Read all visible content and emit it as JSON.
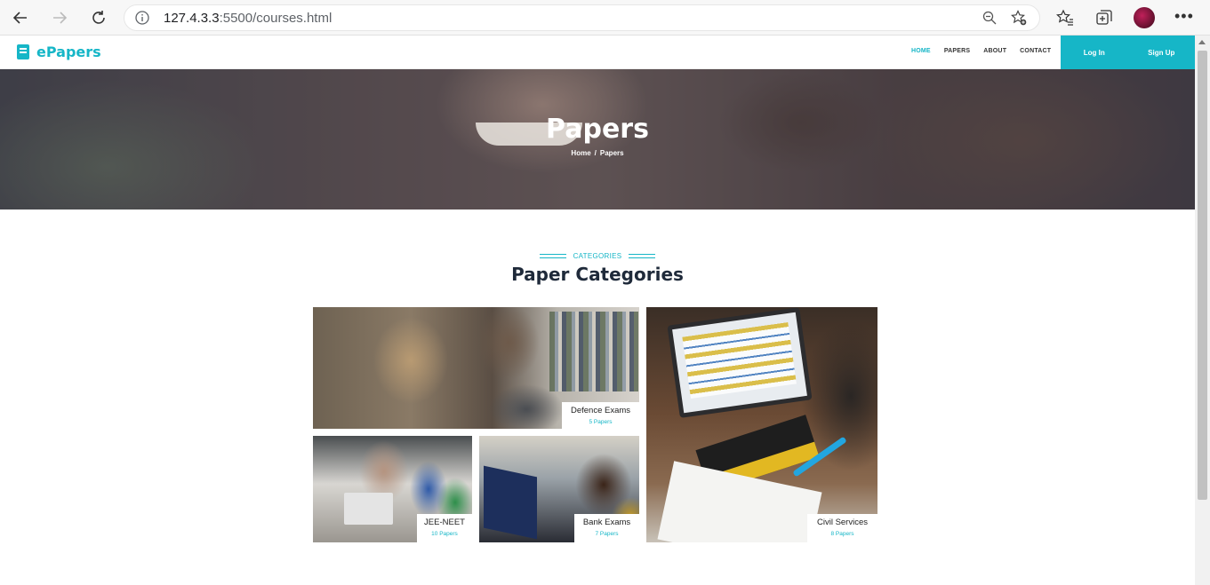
{
  "browser": {
    "url_host": "127.4.3.3",
    "url_rest": ":5500/courses.html"
  },
  "site": {
    "brand": "ePapers",
    "nav": [
      "HOME",
      "PAPERS",
      "ABOUT",
      "CONTACT"
    ],
    "active_nav": "HOME",
    "login": "Log In",
    "signup": "Sign Up",
    "accent_color": "#16b6c7"
  },
  "hero": {
    "title": "Papers",
    "breadcrumb_home": "Home",
    "breadcrumb_sep": "/",
    "breadcrumb_current": "Papers"
  },
  "section": {
    "tag": "CATEGORIES",
    "title": "Paper Categories"
  },
  "categories": [
    {
      "title": "Defence Exams",
      "count": "5 Papers"
    },
    {
      "title": "JEE-NEET",
      "count": "10 Papers"
    },
    {
      "title": "Bank Exams",
      "count": "7 Papers"
    },
    {
      "title": "Civil Services",
      "count": "8 Papers"
    }
  ]
}
